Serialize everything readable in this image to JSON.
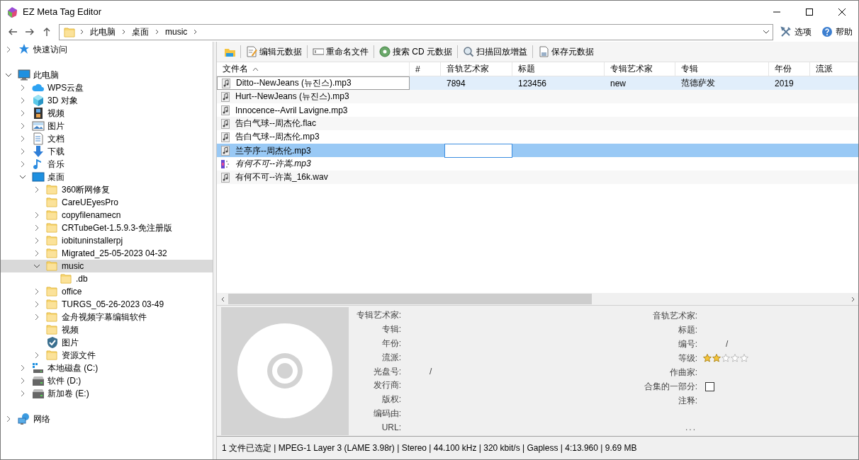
{
  "window": {
    "title": "EZ Meta Tag Editor"
  },
  "address_bar": {
    "crumbs": [
      "此电脑",
      "桌面",
      "music"
    ]
  },
  "menu_buttons": [
    {
      "label": "选项",
      "kind": "options"
    },
    {
      "label": "帮助",
      "kind": "help"
    }
  ],
  "tree": [
    {
      "label": "快速访问",
      "kind": "star",
      "expanded": false,
      "selected": false
    },
    {
      "label": "此电脑",
      "kind": "pc",
      "expanded": true,
      "selected": false,
      "children": [
        {
          "label": "WPS云盘",
          "kind": "cloud",
          "expanded": false,
          "selected": false
        },
        {
          "label": "3D 对象",
          "kind": "cube",
          "expanded": false,
          "selected": false
        },
        {
          "label": "视频",
          "kind": "film",
          "expanded": false,
          "selected": false
        },
        {
          "label": "图片",
          "kind": "image",
          "expanded": false,
          "selected": false
        },
        {
          "label": "文档",
          "kind": "doc",
          "expanded": false,
          "selected": false
        },
        {
          "label": "下载",
          "kind": "download",
          "expanded": false,
          "selected": false
        },
        {
          "label": "音乐",
          "kind": "note",
          "expanded": false,
          "selected": false
        },
        {
          "label": "桌面",
          "kind": "desktop",
          "expanded": true,
          "selected": false,
          "children": [
            {
              "label": "360断网修复",
              "kind": "folder",
              "expanded": false,
              "selected": false
            },
            {
              "label": "CareUEyesPro",
              "kind": "folder",
              "selected": false
            },
            {
              "label": "copyfilenamecn",
              "kind": "folder",
              "expanded": false,
              "selected": false
            },
            {
              "label": "CRTubeGet-1.5.9.3-免注册版",
              "kind": "folder",
              "expanded": false,
              "selected": false
            },
            {
              "label": "iobituninstallerpj",
              "kind": "folder",
              "expanded": false,
              "selected": false
            },
            {
              "label": "Migrated_25-05-2023 04-32",
              "kind": "folder",
              "expanded": false,
              "selected": false
            },
            {
              "label": "music",
              "kind": "folder",
              "expanded": true,
              "selected": true,
              "children": [
                {
                  "label": ".db",
                  "kind": "folder",
                  "selected": false
                }
              ]
            },
            {
              "label": "office",
              "kind": "folder",
              "expanded": false,
              "selected": false
            },
            {
              "label": "TURGS_05-26-2023 03-49",
              "kind": "folder",
              "expanded": false,
              "selected": false
            },
            {
              "label": "金舟视频字幕编辑软件",
              "kind": "folder",
              "expanded": false,
              "selected": false
            },
            {
              "label": "视频",
              "kind": "folder",
              "selected": false
            },
            {
              "label": "图片",
              "kind": "shield",
              "selected": false
            },
            {
              "label": "资源文件",
              "kind": "folder",
              "expanded": false,
              "selected": false
            }
          ]
        },
        {
          "label": "本地磁盘 (C:)",
          "kind": "sysdrive",
          "expanded": false,
          "selected": false
        },
        {
          "label": "软件 (D:)",
          "kind": "drive",
          "expanded": false,
          "selected": false
        },
        {
          "label": "新加卷 (E:)",
          "kind": "drive",
          "expanded": false,
          "selected": false
        }
      ]
    },
    {
      "label": "网络",
      "kind": "network",
      "expanded": false,
      "selected": false
    }
  ],
  "toolbar": [
    {
      "kind": "open"
    },
    {
      "kind": "edit",
      "label": "编辑元数据"
    },
    {
      "kind": "rename",
      "label": "重命名文件"
    },
    {
      "kind": "cd",
      "label": "搜索 CD 元数据"
    },
    {
      "kind": "scan",
      "label": "扫描回放增益"
    },
    {
      "kind": "save",
      "label": "保存元数据"
    }
  ],
  "table": {
    "columns": [
      {
        "label": "文件名",
        "sorted": true
      },
      {
        "label": "#",
        "sorted": false
      },
      {
        "label": "音轨艺术家",
        "sorted": false
      },
      {
        "label": "标题",
        "sorted": false
      },
      {
        "label": "专辑艺术家",
        "sorted": false
      },
      {
        "label": "专辑",
        "sorted": false
      },
      {
        "label": "年份",
        "sorted": false
      },
      {
        "label": "流派",
        "sorted": false
      }
    ],
    "rows": [
      {
        "file_name": "Ditto--NewJeans (뉴진스).mp3",
        "track_artist": "7894",
        "title": "123456",
        "album_artist": "new",
        "album": "范德萨发",
        "year": "2019",
        "kind": "audio",
        "selected": false,
        "focused": true,
        "editing": false,
        "italic": false
      },
      {
        "file_name": "Hurt--NewJeans (뉴진스).mp3",
        "kind": "audio",
        "selected": false,
        "focused": false,
        "editing": false,
        "italic": false
      },
      {
        "file_name": "Innocence--Avril Lavigne.mp3",
        "kind": "audio",
        "selected": false,
        "focused": false,
        "editing": false,
        "italic": false
      },
      {
        "file_name": "告白气球--周杰伦.flac",
        "kind": "audio",
        "selected": false,
        "focused": false,
        "editing": false,
        "italic": false
      },
      {
        "file_name": "告白气球--周杰伦.mp3",
        "kind": "audio",
        "selected": false,
        "focused": false,
        "editing": false,
        "italic": false
      },
      {
        "file_name": "兰亭序--周杰伦.mp3",
        "kind": "audio",
        "selected": true,
        "focused": false,
        "editing": true,
        "italic": false
      },
      {
        "file_name": "有何不可--许嵩.mp3",
        "kind": "thumbnail",
        "selected": false,
        "focused": false,
        "editing": false,
        "italic": true
      },
      {
        "file_name": "有何不可--许嵩_16k.wav",
        "kind": "audio",
        "selected": false,
        "focused": false,
        "editing": false,
        "italic": false
      }
    ]
  },
  "details": {
    "cover": {
      "kind": "placeholder"
    },
    "left_fields": [
      {
        "label": "专辑艺术家:"
      },
      {
        "label": "专辑:"
      },
      {
        "label": "年份:"
      },
      {
        "label": "流派:"
      },
      {
        "label": "光盘号:",
        "value": "/"
      },
      {
        "label": "发行商:"
      },
      {
        "label": "版权:"
      },
      {
        "label": "编码由:"
      },
      {
        "label": "URL:"
      }
    ],
    "right_fields": [
      {
        "kind": "text",
        "label": "音轨艺术家:"
      },
      {
        "kind": "text",
        "label": "标题:"
      },
      {
        "kind": "text",
        "label": "编号:",
        "value": "/"
      },
      {
        "kind": "rating",
        "label": "等级:",
        "stars": 2
      },
      {
        "kind": "text",
        "label": "作曲家:"
      },
      {
        "kind": "checkbox",
        "label": "合集的一部分:",
        "checked": false
      },
      {
        "kind": "text",
        "label": "注释:"
      },
      {
        "kind": "more",
        "label": "..."
      }
    ]
  },
  "status_bar": "1 文件已选定 | MPEG-1 Layer 3 (LAME 3.98r) | Stereo | 44.100 kHz | 320 kbit/s | Gapless | 4:13.960 | 9.69 MB"
}
